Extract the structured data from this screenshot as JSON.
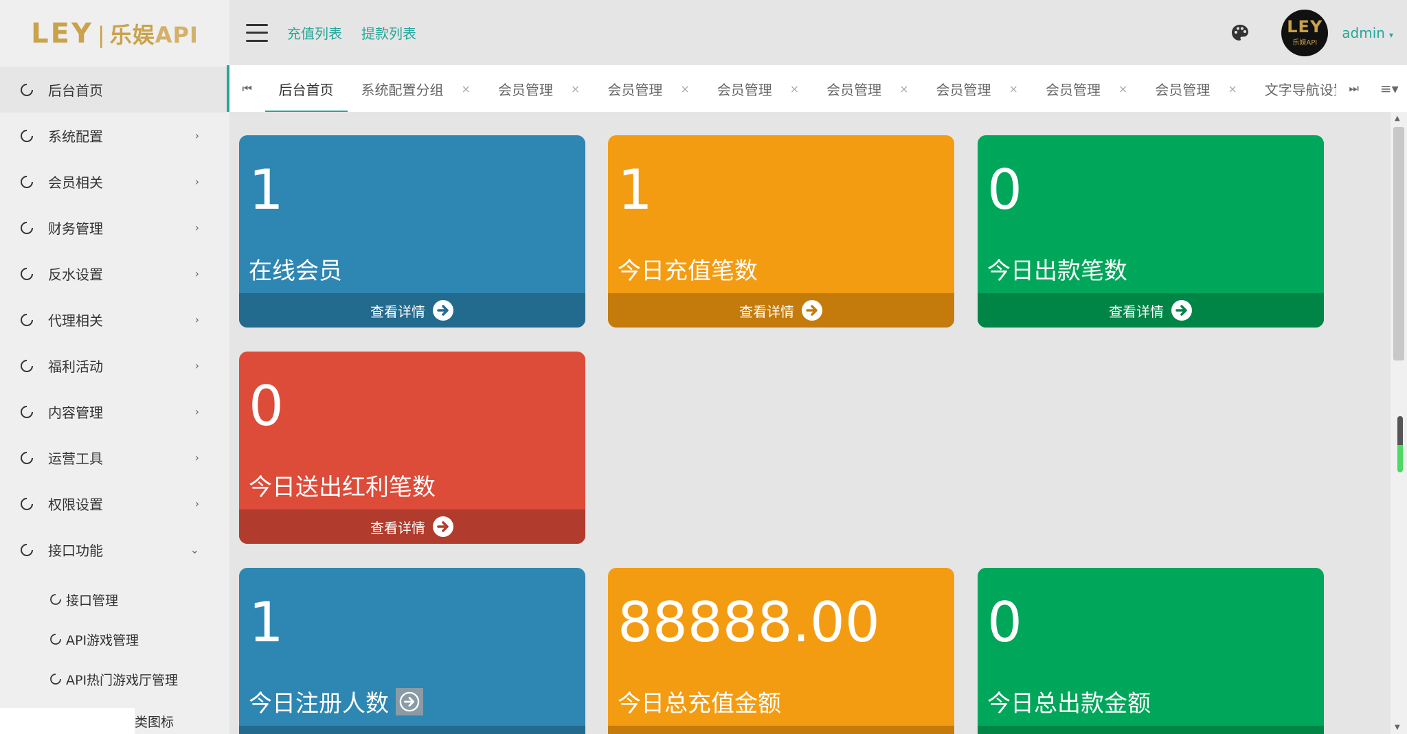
{
  "brand": {
    "logo_mark": "LEY",
    "logo_sep": "|",
    "logo_cn": "乐娱",
    "logo_api": "API",
    "accent": "#26a69a"
  },
  "sidebar": {
    "items": [
      {
        "label": "后台首页",
        "arrow": ""
      },
      {
        "label": "系统配置",
        "arrow": "›"
      },
      {
        "label": "会员相关",
        "arrow": "›"
      },
      {
        "label": "财务管理",
        "arrow": "›"
      },
      {
        "label": "反水设置",
        "arrow": "›"
      },
      {
        "label": "代理相关",
        "arrow": "›"
      },
      {
        "label": "福利活动",
        "arrow": "›"
      },
      {
        "label": "内容管理",
        "arrow": "›"
      },
      {
        "label": "运营工具",
        "arrow": "›"
      },
      {
        "label": "权限设置",
        "arrow": "›"
      },
      {
        "label": "接口功能",
        "arrow": "⌄"
      }
    ],
    "sub_items": [
      {
        "label": "接口管理"
      },
      {
        "label": "API游戏管理"
      },
      {
        "label": "API热门游戏厅管理"
      }
    ],
    "bottom_fragment": "类图标"
  },
  "topbar": {
    "link1": "充值列表",
    "link2": "提款列表",
    "avatar_mark": "LEY",
    "avatar_sub": "乐娱API",
    "user": "admin",
    "caret": "▾"
  },
  "tabs": {
    "prev": "⏮",
    "next": "⏭",
    "menu": "≡▾",
    "close": "×",
    "items": [
      {
        "label": "后台首页"
      },
      {
        "label": "系统配置分组"
      },
      {
        "label": "会员管理"
      },
      {
        "label": "会员管理"
      },
      {
        "label": "会员管理"
      },
      {
        "label": "会员管理"
      },
      {
        "label": "会员管理"
      },
      {
        "label": "会员管理"
      },
      {
        "label": "会员管理"
      },
      {
        "label": "文字导航设置"
      }
    ]
  },
  "cards": [
    {
      "value": "1",
      "label": "在线会员",
      "footer": "查看详情"
    },
    {
      "value": "1",
      "label": "今日充值笔数",
      "footer": "查看详情"
    },
    {
      "value": "0",
      "label": "今日出款笔数",
      "footer": "查看详情"
    },
    {
      "value": "0",
      "label": "今日送出红利笔数",
      "footer": "查看详情"
    },
    {
      "value": "1",
      "label": "今日注册人数",
      "footer": ""
    },
    {
      "value": "88888.00",
      "label": "今日总充值金额",
      "footer": ""
    },
    {
      "value": "0",
      "label": "今日总出款金额",
      "footer": ""
    }
  ],
  "colors": {
    "blue": "#2e86b2",
    "orange": "#f39c12",
    "green": "#00a65a",
    "red": "#dd4b39"
  }
}
